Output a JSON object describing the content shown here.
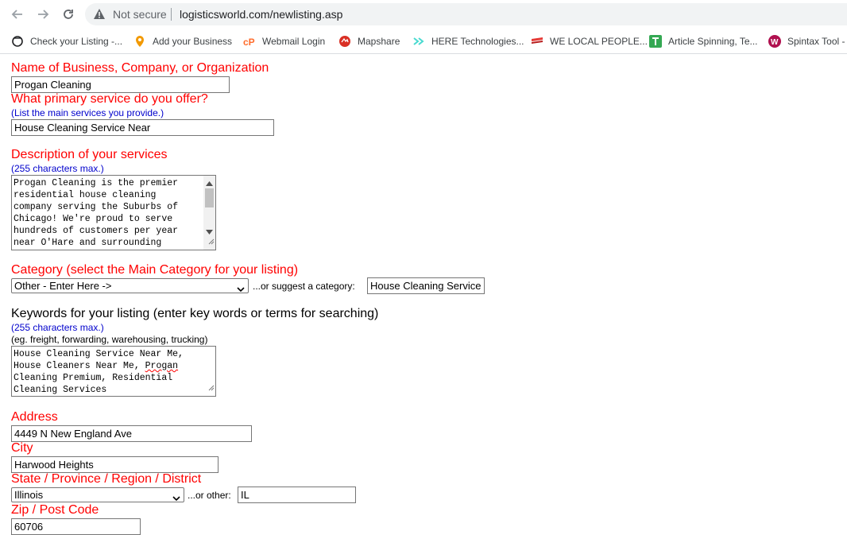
{
  "browser": {
    "security_label": "Not secure",
    "url": "logisticsworld.com/newlisting.asp"
  },
  "bookmarks": [
    {
      "label": "Check your Listing -...",
      "icon": "circle-outline-icon"
    },
    {
      "label": "Add your Business",
      "icon": "location-pin-icon"
    },
    {
      "label": "Webmail Login",
      "icon": "cpanel-icon"
    },
    {
      "label": "Mapshare",
      "icon": "mapshare-icon"
    },
    {
      "label": "HERE Technologies...",
      "icon": "here-icon"
    },
    {
      "label": "WE LOCAL PEOPLE...",
      "icon": "flag-icon"
    },
    {
      "label": "Article Spinning, Te...",
      "icon": "t-icon"
    },
    {
      "label": "Spintax Tool -",
      "icon": "w-icon"
    }
  ],
  "form": {
    "business_name": {
      "label": "Name of Business, Company, or Organization",
      "value": "Progan Cleaning"
    },
    "service": {
      "label": "What primary service do you offer?",
      "hint": "(List the main services you provide.)",
      "value": "House Cleaning Service Near"
    },
    "description": {
      "label": "Description of your services",
      "hint": "(255 characters max.)",
      "lines": [
        "Progan Cleaning is the premier",
        "residential house cleaning",
        "company serving the Suburbs of",
        "Chicago! We're proud to serve",
        "hundreds of customers per year",
        "near O'Hare and surrounding"
      ]
    },
    "category": {
      "label": "Category (select the Main Category for your listing)",
      "selected": "Other - Enter Here ->",
      "suggest_label": "...or suggest a category:",
      "suggest_value": "House Cleaning Service"
    },
    "keywords": {
      "label": "Keywords for your listing (enter key words or terms for searching)",
      "hint": "(255 characters max.)",
      "example": "(eg. freight, forwarding, warehousing, trucking)",
      "lines": [
        "House Cleaning Service Near Me,",
        "House Cleaners Near Me, ",
        "Cleaning Premium, Residential",
        "Cleaning Services"
      ],
      "misspelled_word": "Progan"
    },
    "address": {
      "label": "Address",
      "value": "4449 N New England Ave"
    },
    "city": {
      "label": "City",
      "value": "Harwood Heights"
    },
    "state": {
      "label": "State / Province / Region / District",
      "selected": "Illinois",
      "other_label": "...or other:",
      "other_value": "IL"
    },
    "zip": {
      "label": "Zip / Post Code",
      "value": "60706"
    }
  }
}
